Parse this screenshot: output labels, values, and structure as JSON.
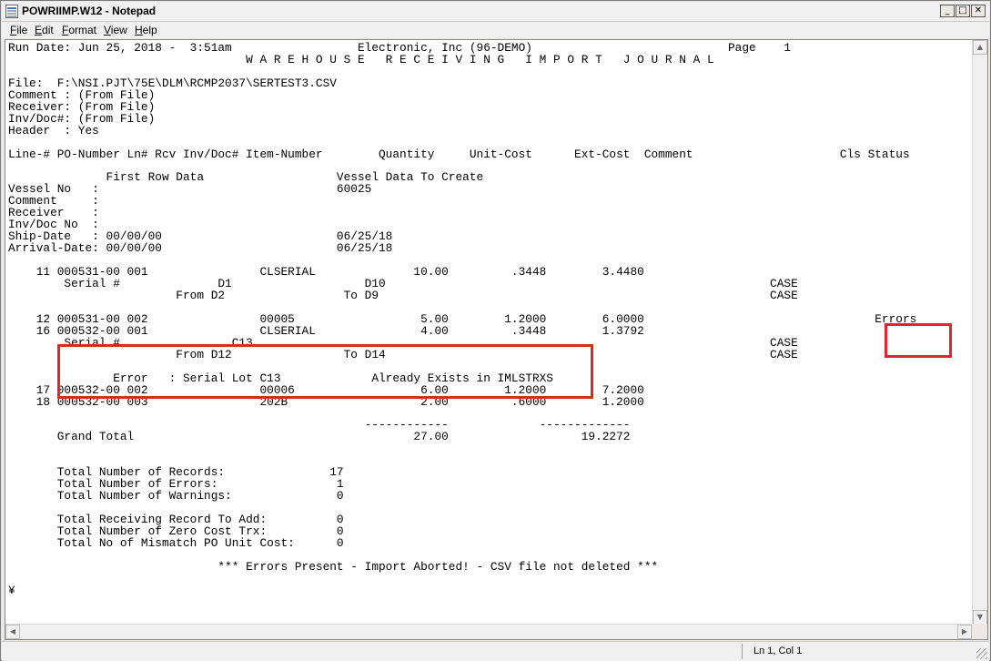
{
  "window": {
    "title": "POWRIIMP.W12 - Notepad",
    "minimize_glyph": "_",
    "maximize_glyph": "□",
    "close_glyph": "✕"
  },
  "menu": [
    {
      "label": "File",
      "key": "F",
      "rest": "ile"
    },
    {
      "label": "Edit",
      "key": "E",
      "rest": "dit"
    },
    {
      "label": "Format",
      "key": "F",
      "rest": "ormat",
      "pre": "",
      "underline_index": 0
    },
    {
      "label": "View",
      "key": "V",
      "rest": "iew"
    },
    {
      "label": "Help",
      "key": "H",
      "rest": "elp"
    }
  ],
  "document": {
    "lines": [
      "Run Date: Jun 25, 2018 -  3:51am                  Electronic, Inc (96-DEMO)                            Page    1",
      "                                  W A R E H O U S E   R E C E I V I N G   I M P O R T   J O U R N A L",
      "",
      "File:  F:\\NSI.PJT\\75E\\DLM\\RCMP2037\\SERTEST3.CSV",
      "Comment : (From File)",
      "Receiver: (From File)",
      "Inv/Doc#: (From File)",
      "Header  : Yes",
      "",
      "Line-# PO-Number Ln# Rcv Inv/Doc# Item-Number        Quantity     Unit-Cost      Ext-Cost  Comment                     Cls Status",
      "",
      "              First Row Data                   Vessel Data To Create",
      "Vessel No   :                                  60025",
      "Comment     :",
      "Receiver    :",
      "Inv/Doc No  :",
      "Ship-Date   : 00/00/00                         06/25/18",
      "Arrival-Date: 00/00/00                         06/25/18",
      "",
      "    11 000531-00 001                CLSERIAL              10.00         .3448        3.4480",
      "        Serial #              D1                   D10                                                       CASE",
      "                        From D2                 To D9                                                        CASE",
      "",
      "    12 000531-00 002                00005                  5.00        1.2000        6.0000                                 Errors",
      "    16 000532-00 001                CLSERIAL               4.00         .3448        1.3792",
      "        Serial #                C13                                                                          CASE",
      "                        From D12                To D14                                                       CASE",
      "",
      "               Error   : Serial Lot C13             Already Exists in IMLSTRXS",
      "    17 000532-00 002                00006                  6.00        1.2000        7.2000",
      "    18 000532-00 003                202B                   2.00         .6000        1.2000",
      "",
      "                                                   ------------             -------------",
      "       Grand Total                                        27.00                   19.2272",
      "",
      "",
      "       Total Number of Records:               17",
      "       Total Number of Errors:                 1",
      "       Total Number of Warnings:               0",
      "",
      "       Total Receiving Record To Add:          0",
      "       Total Number of Zero Cost Trx:          0",
      "       Total No of Mismatch PO Unit Cost:      0",
      "",
      "                              *** Errors Present - Import Aborted! - CSV file not deleted ***",
      "",
      "¥"
    ]
  },
  "status": {
    "position": "Ln 1, Col 1"
  },
  "colors": {
    "highlight": "#e0262d"
  }
}
